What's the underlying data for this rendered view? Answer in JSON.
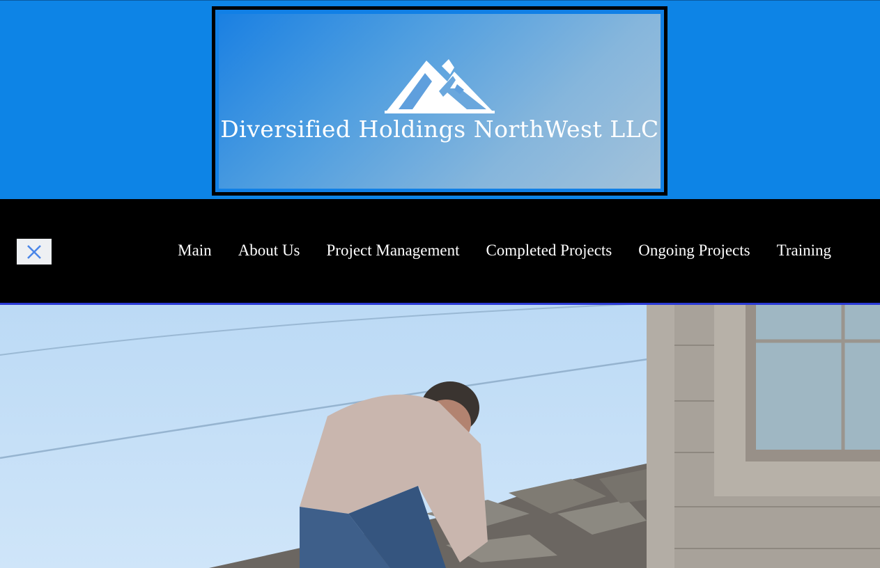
{
  "site": {
    "brand_name": "Diversified Holdings NorthWest LLC",
    "logo_icon": "mountain-logo-icon"
  },
  "nav": {
    "close_icon": "close-icon",
    "items": [
      {
        "label": "Main"
      },
      {
        "label": "About Us"
      },
      {
        "label": "Project Management"
      },
      {
        "label": "Completed Projects"
      },
      {
        "label": "Ongoing Projects"
      },
      {
        "label": "Training"
      }
    ]
  },
  "colors": {
    "header_bg": "#0d84e6",
    "nav_bg": "#000000",
    "nav_border": "#2b3bd6",
    "close_icon": "#4a86e8"
  },
  "hero": {
    "image": "roofer-on-roof-photo"
  }
}
